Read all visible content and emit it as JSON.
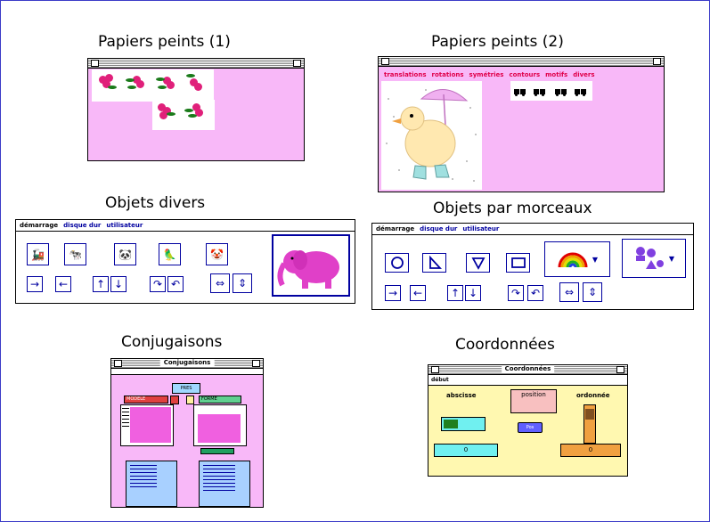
{
  "titles": {
    "pp1": "Papiers peints (1)",
    "pp2": "Papiers peints (2)",
    "objets_divers": "Objets divers",
    "objets_morceaux": "Objets par morceaux",
    "conjugaisons": "Conjugaisons",
    "coordonnees": "Coordonnées"
  },
  "pp2_menu": [
    "translations",
    "rotations",
    "symétries",
    "contours",
    "motifs",
    "divers"
  ],
  "divers_menu": [
    "démarrage",
    "disque dur",
    "utilisateur"
  ],
  "morceaux_menu": [
    "démarrage",
    "disque dur",
    "utilisateur"
  ],
  "conj": {
    "window_title": "Conjugaisons",
    "top_button": "PRES",
    "left_tag": "MODELE",
    "right_tag": "FORME"
  },
  "coord": {
    "window_title": "Coordonnées",
    "menu": "début",
    "abscisse": "abscisse",
    "ordonnee": "ordonnée",
    "position": "position",
    "button": "Pos",
    "x_value": "0",
    "y_value": "0"
  },
  "colors": {
    "frame": "#3b3bc8",
    "pink": "#f8b8f8",
    "menu_red": "#e0004a",
    "icon_blue": "#0000a0",
    "elephant": "#e040c8",
    "cyan": "#70f0f0",
    "orange": "#f0a040",
    "yellow": "#fff8b0"
  }
}
